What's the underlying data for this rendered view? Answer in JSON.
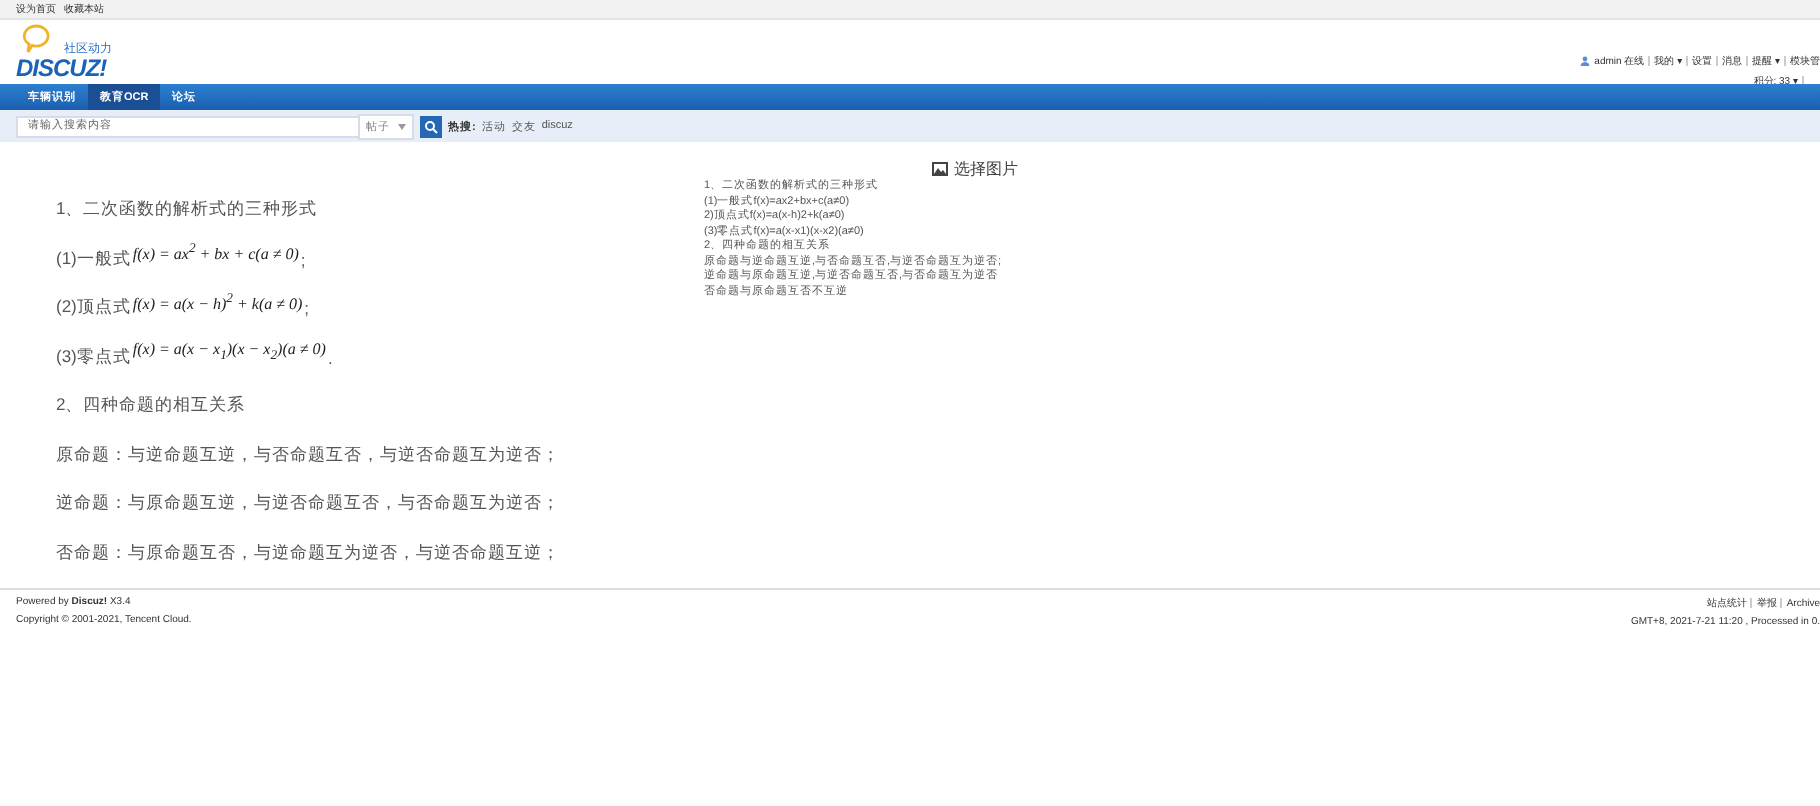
{
  "top_bar": {
    "links": [
      "设为首页",
      "收藏本站"
    ]
  },
  "header": {
    "logo": {
      "tagline": "社区动力",
      "wordmark": "DISCUZ!"
    },
    "user_menu": [
      "admin 在线",
      "我的 ▾",
      "设置",
      "消息",
      "提醒 ▾",
      "模块管"
    ],
    "credits": "积分: 33 ▾"
  },
  "nav": {
    "tabs": [
      {
        "label": "车辆识别",
        "selected": false
      },
      {
        "label": "教育OCR",
        "selected": true
      },
      {
        "label": "论坛",
        "selected": false
      }
    ]
  },
  "search": {
    "placeholder": "请输入搜索内容",
    "scope": "帖子",
    "hot_label": "热搜:",
    "hot_terms": [
      "活动",
      "交友",
      "discuz"
    ]
  },
  "upload": {
    "label": "选择图片"
  },
  "document": {
    "lines": [
      {
        "kind": "heading",
        "text": "1、二次函数的解析式的三种形式"
      },
      {
        "kind": "formula",
        "text": "(1)一般式",
        "formula": "f(x) = ax$^{2}$ + bx + c(a ≠ 0)",
        "end": ";"
      },
      {
        "kind": "formula",
        "text": "(2)顶点式",
        "formula": "f(x) = a(x − h)$^{2}$ + k(a ≠ 0)",
        "end": ";"
      },
      {
        "kind": "formula",
        "text": "(3)零点式",
        "formula": "f(x) = a(x − x$_{1}$)(x − x$_{2}$)(a ≠ 0)",
        "end": "."
      },
      {
        "kind": "heading",
        "text": "2、四种命题的相互关系"
      },
      {
        "kind": "heading",
        "text": "原命题：与逆命题互逆，与否命题互否，与逆否命题互为逆否；"
      },
      {
        "kind": "heading",
        "text": "逆命题：与原命题互逆，与逆否命题互否，与否命题互为逆否；"
      },
      {
        "kind": "heading",
        "text": "否命题：与原命题互否，与逆命题互为逆否，与逆否命题互逆；"
      }
    ]
  },
  "ocr_result": {
    "lines": [
      "1、二次函数的解析式的三种形式",
      "(1)一般式f(x)=ax2+bx+c(a≠0)",
      "2)顶点式f(x)=a(x-h)2+k(a≠0)",
      "(3)零点式f(x)=a(x-x1)(x-x2)(a≠0)",
      "2、四种命题的相互关系",
      "原命题与逆命题互逆,与否命题互否,与逆否命题互为逆否;",
      "逆命题与原命题互逆,与逆否命题互否,与否命题互为逆否",
      "否命题与原命题互否不互逆"
    ]
  },
  "footer": {
    "powered": "Powered by **Discuz!** X3.4",
    "copyright": "Copyright © 2001-2021, Tencent Cloud.",
    "links": [
      "站点统计",
      "举报",
      "Archive"
    ],
    "time": "GMT+8, 2021-7-21 11:20 , Processed in 0."
  }
}
